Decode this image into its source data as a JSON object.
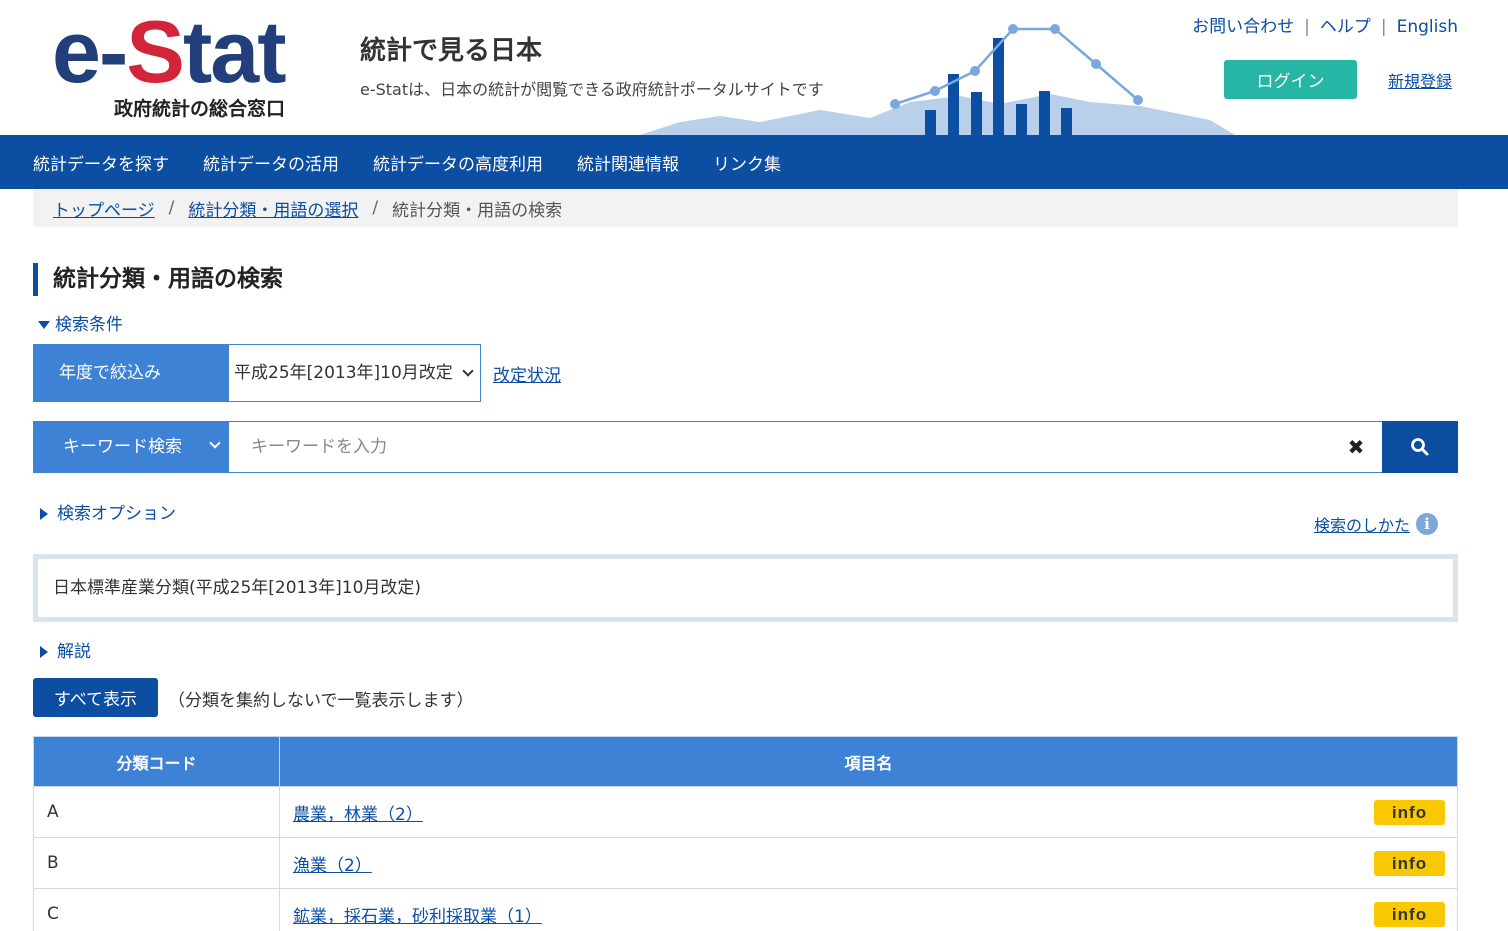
{
  "header": {
    "logo_main": "e-",
    "logo_accent": "S",
    "logo_rest": "tat",
    "logo_subtitle": "政府統計の総合窓口",
    "site_title": "統計で見る日本",
    "site_description": "e-Statは、日本の統計が閲覧できる政府統計ポータルサイトです",
    "links": [
      "お問い合わせ",
      "ヘルプ",
      "English"
    ],
    "login_label": "ログイン",
    "register_label": "新規登録"
  },
  "nav": {
    "items": [
      "統計データを探す",
      "統計データの活用",
      "統計データの高度利用",
      "統計関連情報",
      "リンク集"
    ]
  },
  "breadcrumb": {
    "items": [
      "トップページ",
      "統計分類・用語の選択"
    ],
    "current": "統計分類・用語の検索"
  },
  "page": {
    "title": "統計分類・用語の検索",
    "conditions_toggle": "検索条件"
  },
  "year_filter": {
    "label": "年度で絞込み",
    "selected": "平成25年[2013年]10月改定",
    "revision_link": "改定状況"
  },
  "keyword_search": {
    "type_label": "キーワード検索",
    "placeholder": "キーワードを入力",
    "value": ""
  },
  "search_options_toggle": "検索オプション",
  "howto_link": "検索のしかた",
  "classification_name": "日本標準産業分類(平成25年[2013年]10月改定)",
  "explanation_toggle": "解説",
  "show_all": {
    "button_label": "すべて表示",
    "note": "（分類を集約しないで一覧表示します）"
  },
  "table": {
    "headers": [
      "分類コード",
      "項目名"
    ],
    "info_label": "info",
    "rows": [
      {
        "code": "A",
        "name": "農業，林業（2）"
      },
      {
        "code": "B",
        "name": "漁業（2）"
      },
      {
        "code": "C",
        "name": "鉱業，採石業，砂利採取業（1）"
      }
    ]
  },
  "colors": {
    "brand_blue": "#0b4ea2",
    "accent_blue": "#3e82d6",
    "logo_red": "#d2253a",
    "login_teal": "#27b6a6",
    "info_yellow": "#f9c800"
  }
}
